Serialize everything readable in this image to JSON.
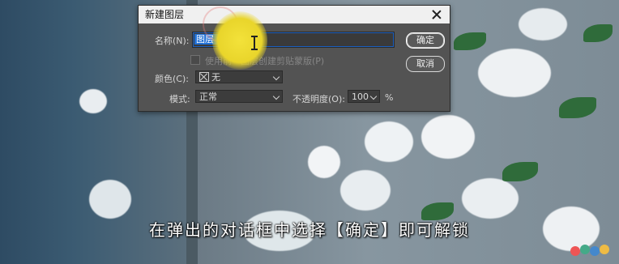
{
  "dialog": {
    "title": "新建图层",
    "name_label": "名称(N):",
    "name_value": "图层 0",
    "clipping_label": "使用前一图层创建剪贴蒙版(P)",
    "color_label": "颜色(C):",
    "color_value": "无",
    "mode_label": "模式:",
    "mode_value": "正常",
    "opacity_label": "不透明度(O):",
    "opacity_value": "100",
    "opacity_unit": "%",
    "ok_label": "确定",
    "cancel_label": "取消"
  },
  "subtitle": "在弹出的对话框中选择【确定】即可解锁",
  "colors": {
    "dialog_bg": "#535353",
    "selection": "#1f6fd6",
    "highlight_spot": "#f3e23a"
  }
}
